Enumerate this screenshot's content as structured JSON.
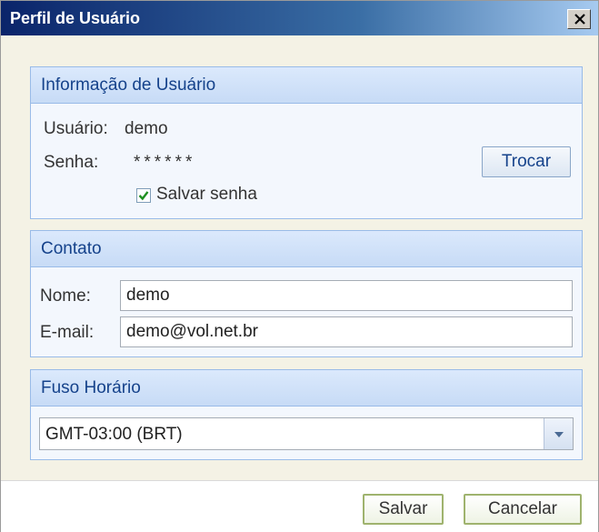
{
  "window": {
    "title": "Perfil de Usuário"
  },
  "user_info": {
    "header": "Informação de Usuário",
    "user_label": "Usuário:",
    "user_value": "demo",
    "password_label": "Senha:",
    "password_value": "******",
    "change_button": "Trocar",
    "save_password_label": "Salvar senha",
    "save_password_checked": true
  },
  "contact": {
    "header": "Contato",
    "name_label": "Nome:",
    "name_value": "demo",
    "email_label": "E-mail:",
    "email_value": "demo@vol.net.br"
  },
  "timezone": {
    "header": "Fuso Horário",
    "selected": "GMT-03:00 (BRT)"
  },
  "footer": {
    "save_button": "Salvar",
    "cancel_button": "Cancelar"
  },
  "icons": {
    "close": "close-icon",
    "checkmark": "checkmark-icon",
    "dropdown": "chevron-down-icon"
  },
  "colors": {
    "title_bar": "#0a246a",
    "panel_header": "#c7dbf6",
    "panel_border": "#99bbe8",
    "check_green": "#1f8f1f"
  }
}
